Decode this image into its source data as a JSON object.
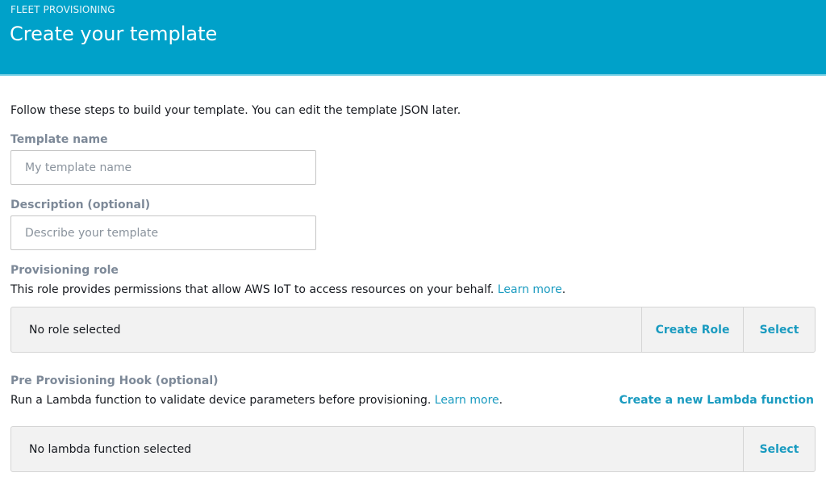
{
  "header": {
    "eyebrow": "FLEET PROVISIONING",
    "title": "Create your template",
    "background_color": "#00a1c9"
  },
  "intro": "Follow these steps to build your template. You can edit the template JSON later.",
  "template_name": {
    "label": "Template name",
    "value": "",
    "placeholder": "My template name"
  },
  "description": {
    "label": "Description (optional)",
    "value": "",
    "placeholder": "Describe your template"
  },
  "provisioning_role": {
    "label": "Provisioning role",
    "help_text": "This role provides permissions that allow AWS IoT to access resources on your behalf.",
    "learn_more": "Learn more",
    "help_suffix": ".",
    "selected_value": "No role selected",
    "create_button": "Create Role",
    "select_button": "Select"
  },
  "pre_provisioning_hook": {
    "label": "Pre Provisioning Hook (optional)",
    "help_text": "Run a Lambda function to validate device parameters before provisioning.",
    "learn_more": "Learn more",
    "help_suffix": ".",
    "create_link": "Create a new Lambda function",
    "selected_value": "No lambda function selected",
    "select_button": "Select"
  },
  "colors": {
    "accent_link": "#1a9bc0",
    "label_gray": "#7d8998",
    "selector_bg": "#f2f2f2"
  }
}
